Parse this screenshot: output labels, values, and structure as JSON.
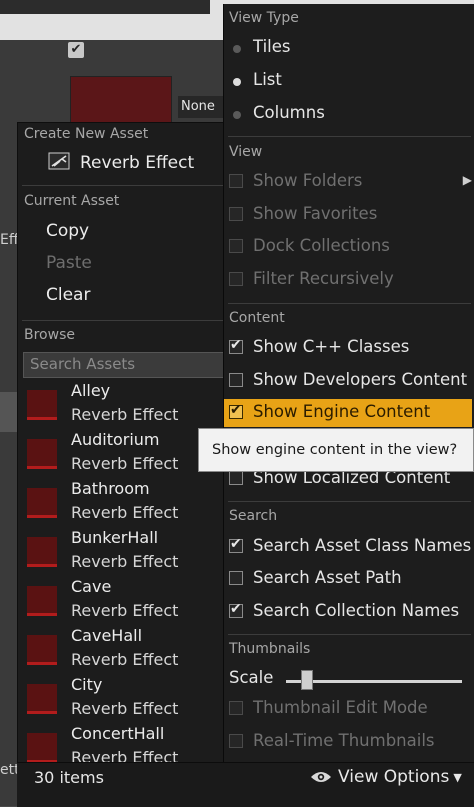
{
  "background": {
    "none_label": "None",
    "left_text_1": "Eff",
    "left_text_2": "etti"
  },
  "asset_menu": {
    "create_header": "Create New Asset",
    "create_item": "Reverb Effect",
    "current_header": "Current Asset",
    "actions": [
      {
        "label": "Copy",
        "enabled": true
      },
      {
        "label": "Paste",
        "enabled": false
      },
      {
        "label": "Clear",
        "enabled": true
      }
    ],
    "browse_header": "Browse",
    "search_placeholder": "Search Assets",
    "assets": [
      {
        "name": "Alley",
        "type": "Reverb Effect"
      },
      {
        "name": "Auditorium",
        "type": "Reverb Effect"
      },
      {
        "name": "Bathroom",
        "type": "Reverb Effect"
      },
      {
        "name": "BunkerHall",
        "type": "Reverb Effect"
      },
      {
        "name": "Cave",
        "type": "Reverb Effect"
      },
      {
        "name": "CaveHall",
        "type": "Reverb Effect"
      },
      {
        "name": "City",
        "type": "Reverb Effect"
      },
      {
        "name": "ConcertHall",
        "type": "Reverb Effect"
      }
    ]
  },
  "status_bar": {
    "item_count": "30 items",
    "view_options": "View Options"
  },
  "view_menu": {
    "view_type_header": "View Type",
    "view_types": [
      {
        "label": "Tiles",
        "selected": false
      },
      {
        "label": "List",
        "selected": true
      },
      {
        "label": "Columns",
        "selected": false
      }
    ],
    "view_header": "View",
    "view_items": [
      {
        "label": "Show Folders",
        "checked": false,
        "enabled": false
      },
      {
        "label": "Show Favorites",
        "checked": false,
        "enabled": false
      },
      {
        "label": "Dock Collections",
        "checked": false,
        "enabled": false
      },
      {
        "label": "Filter Recursively",
        "checked": false,
        "enabled": false
      }
    ],
    "content_header": "Content",
    "content_items": [
      {
        "label": "Show C++ Classes",
        "checked": true
      },
      {
        "label": "Show Developers Content",
        "checked": false
      },
      {
        "label": "Show Engine Content",
        "checked": true,
        "highlighted": true
      },
      {
        "label": "Show Localized Content",
        "checked": false
      }
    ],
    "search_header": "Search",
    "search_items": [
      {
        "label": "Search Asset Class Names",
        "checked": true
      },
      {
        "label": "Search Asset Path",
        "checked": false
      },
      {
        "label": "Search Collection Names",
        "checked": true
      }
    ],
    "thumbnails_header": "Thumbnails",
    "scale_label": "Scale",
    "scale_value": 0.12,
    "thumbnail_items": [
      {
        "label": "Thumbnail Edit Mode",
        "checked": false,
        "enabled": false
      },
      {
        "label": "Real-Time Thumbnails",
        "checked": false,
        "enabled": false
      }
    ]
  },
  "tooltip": "Show engine content in the view?",
  "colors": {
    "highlight": "#e8a316",
    "asset_thumb": "#5a1212",
    "menu_bg": "#1d1d1d"
  }
}
